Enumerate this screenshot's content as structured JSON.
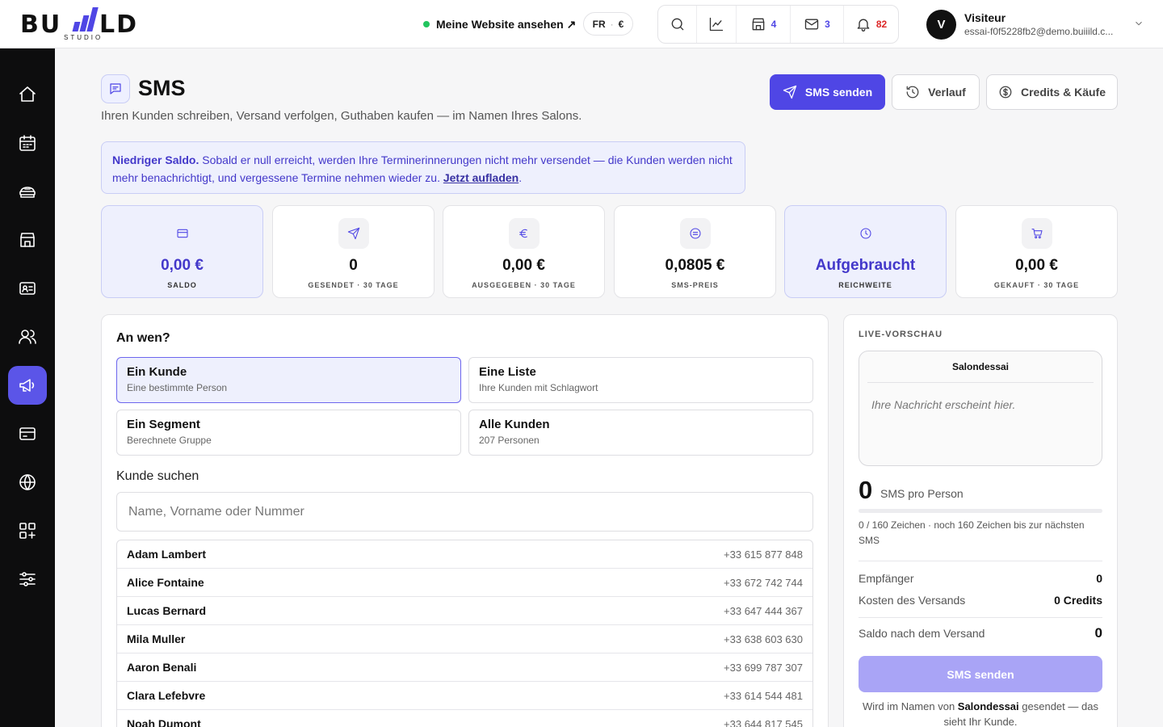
{
  "brand": {
    "left": "BU",
    "right": "LD",
    "sub": "STUDIO",
    "accent": "#4f46e5"
  },
  "topbar": {
    "site_link": "Meine Website ansehen ↗",
    "lang": "FR",
    "currency": "€",
    "counts": {
      "shop": "4",
      "mail": "3",
      "notifications": "82"
    },
    "user_initial": "V",
    "user_name": "Visiteur",
    "user_email": "essai-f0f5228fb2@demo.buiiild.c..."
  },
  "sidebar_icons": [
    "home-icon",
    "calendar-icon",
    "services-icon",
    "store-icon",
    "id-card-icon",
    "users-icon",
    "megaphone-icon",
    "card-icon",
    "globe-icon",
    "apps-icon",
    "sliders-icon"
  ],
  "header": {
    "title": "SMS",
    "subtitle": "Ihren Kunden schreiben, Versand verfolgen, Guthaben kaufen — im Namen Ihres Salons.",
    "send_label": "SMS senden",
    "history_label": "Verlauf",
    "credits_label": "Credits & Käufe"
  },
  "alert": {
    "bold": "Niedriger Saldo.",
    "text": " Sobald er null erreicht, werden Ihre Terminerinnerungen nicht mehr versendet — die Kunden werden nicht mehr benachrichtigt, und vergessene Termine nehmen wieder zu. ",
    "link": "Jetzt aufladen",
    "end": "."
  },
  "stats": [
    {
      "value": "0,00 €",
      "label": "SALDO"
    },
    {
      "value": "0",
      "label": "GESENDET · 30 TAGE"
    },
    {
      "value": "0,00 €",
      "label": "AUSGEGEBEN · 30 TAGE"
    },
    {
      "value": "0,0805 €",
      "label": "SMS-PREIS"
    },
    {
      "value": "Aufgebraucht",
      "label": "REICHWEITE"
    },
    {
      "value": "0,00 €",
      "label": "GEKAUFT · 30 TAGE"
    }
  ],
  "audience": {
    "heading": "An wen?",
    "options": [
      {
        "title": "Ein Kunde",
        "sub": "Eine bestimmte Person"
      },
      {
        "title": "Eine Liste",
        "sub": "Ihre Kunden mit Schlagwort"
      },
      {
        "title": "Ein Segment",
        "sub": "Berechnete Gruppe"
      },
      {
        "title": "Alle Kunden",
        "sub": "207 Personen"
      }
    ],
    "search_label": "Kunde suchen",
    "search_placeholder": "Name, Vorname oder Nummer",
    "search_value": ""
  },
  "customers": [
    {
      "name": "Adam Lambert",
      "phone": "+33 615 877 848"
    },
    {
      "name": "Alice Fontaine",
      "phone": "+33 672 742 744"
    },
    {
      "name": "Lucas Bernard",
      "phone": "+33 647 444 367"
    },
    {
      "name": "Mila Muller",
      "phone": "+33 638 603 630"
    },
    {
      "name": "Aaron Benali",
      "phone": "+33 699 787 307"
    },
    {
      "name": "Clara Lefebvre",
      "phone": "+33 614 544 481"
    },
    {
      "name": "Noah Dumont",
      "phone": "+33 644 817 545"
    }
  ],
  "preview": {
    "label": "LIVE-VORSCHAU",
    "sender": "Salondessai",
    "placeholder": "Ihre Nachricht erscheint hier.",
    "sms_count": "0",
    "sms_count_label": "SMS pro Person",
    "progress_fraction": 0,
    "chars": "0 / 160 Zeichen · noch 160 Zeichen bis zur nächsten SMS",
    "recipients_label": "Empfänger",
    "recipients_value": "0",
    "cost_label": "Kosten des Versands",
    "cost_value": "0 Credits",
    "balance_label": "Saldo nach dem Versand",
    "balance_value": "0",
    "send_label": "SMS senden",
    "note_pre": "Wird im Namen von ",
    "note_name": "Salondessai",
    "note_post": " gesendet — das sieht Ihr Kunde."
  }
}
